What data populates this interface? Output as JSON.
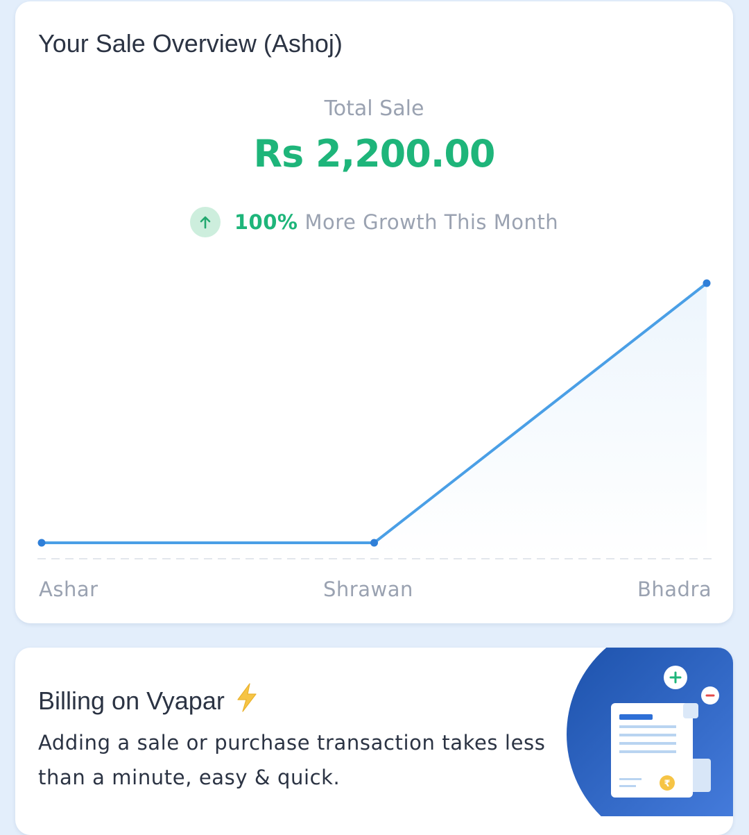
{
  "overview": {
    "title": "Your Sale Overview (Ashoj)",
    "total_label": "Total Sale",
    "total_value": "Rs 2,200.00",
    "growth_icon": "arrow-up-icon",
    "growth_percent": "100%",
    "growth_text": "More Growth This Month"
  },
  "chart_data": {
    "type": "line",
    "categories": [
      "Ashar",
      "Shrawan",
      "Bhadra"
    ],
    "values": [
      0,
      0,
      2200
    ],
    "ylim": [
      0,
      2200
    ],
    "grid": false,
    "line_color": "#4a9fe6"
  },
  "billing": {
    "title": "Billing on Vyapar",
    "title_icon": "lightning-icon",
    "description": "Adding a sale or purchase transaction takes less than a minute, easy & quick.",
    "illustration": "invoice-illustration"
  },
  "colors": {
    "background": "#e3eefb",
    "accent_green": "#1eb57a",
    "muted_text": "#9aa2b1",
    "dark_text": "#2b3343",
    "line_blue": "#4a9fe6",
    "promo_blue": "#2e63c8"
  }
}
